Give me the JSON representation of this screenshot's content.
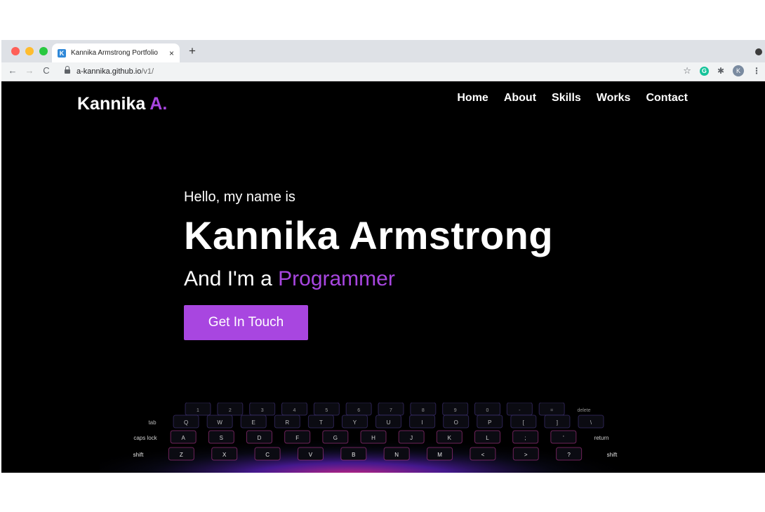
{
  "browser": {
    "tab_title": "Kannika Armstrong Portfolio",
    "tab_favicon": "K",
    "close_tab": "×",
    "new_tab": "+",
    "url_host": "a-kannika.github.io",
    "url_path": "/v1/",
    "back": "←",
    "forward": "→",
    "reload": "C",
    "bookmark": "☆",
    "grammarly_ext": "G",
    "extensions": "✱",
    "profile": "K",
    "menu": "⋮"
  },
  "page": {
    "logo_text": "Kannika",
    "logo_accent": "A.",
    "nav": [
      "Home",
      "About",
      "Skills",
      "Works",
      "Contact"
    ],
    "greeting": "Hello, my name is",
    "name": "Kannika Armstrong",
    "role_prefix": "And I'm a",
    "role_accent": "Programmer",
    "cta": "Get In Touch"
  },
  "colors": {
    "accent": "#a846e0",
    "background": "#000000",
    "text": "#ffffff"
  },
  "keyboard": {
    "row1": [
      "1",
      "2",
      "3",
      "4",
      "5",
      "6",
      "7",
      "8",
      "9",
      "0",
      "-",
      "=",
      "delete"
    ],
    "row2": [
      "tab",
      "Q",
      "W",
      "E",
      "R",
      "T",
      "Y",
      "U",
      "I",
      "O",
      "P",
      "[",
      "]",
      "\\"
    ],
    "row3": [
      "caps lock",
      "A",
      "S",
      "D",
      "F",
      "G",
      "H",
      "J",
      "K",
      "L",
      ";",
      "'",
      "return"
    ],
    "row4": [
      "shift",
      "Z",
      "X",
      "C",
      "V",
      "B",
      "N",
      "M",
      "<",
      ">",
      "?",
      "shift"
    ]
  }
}
